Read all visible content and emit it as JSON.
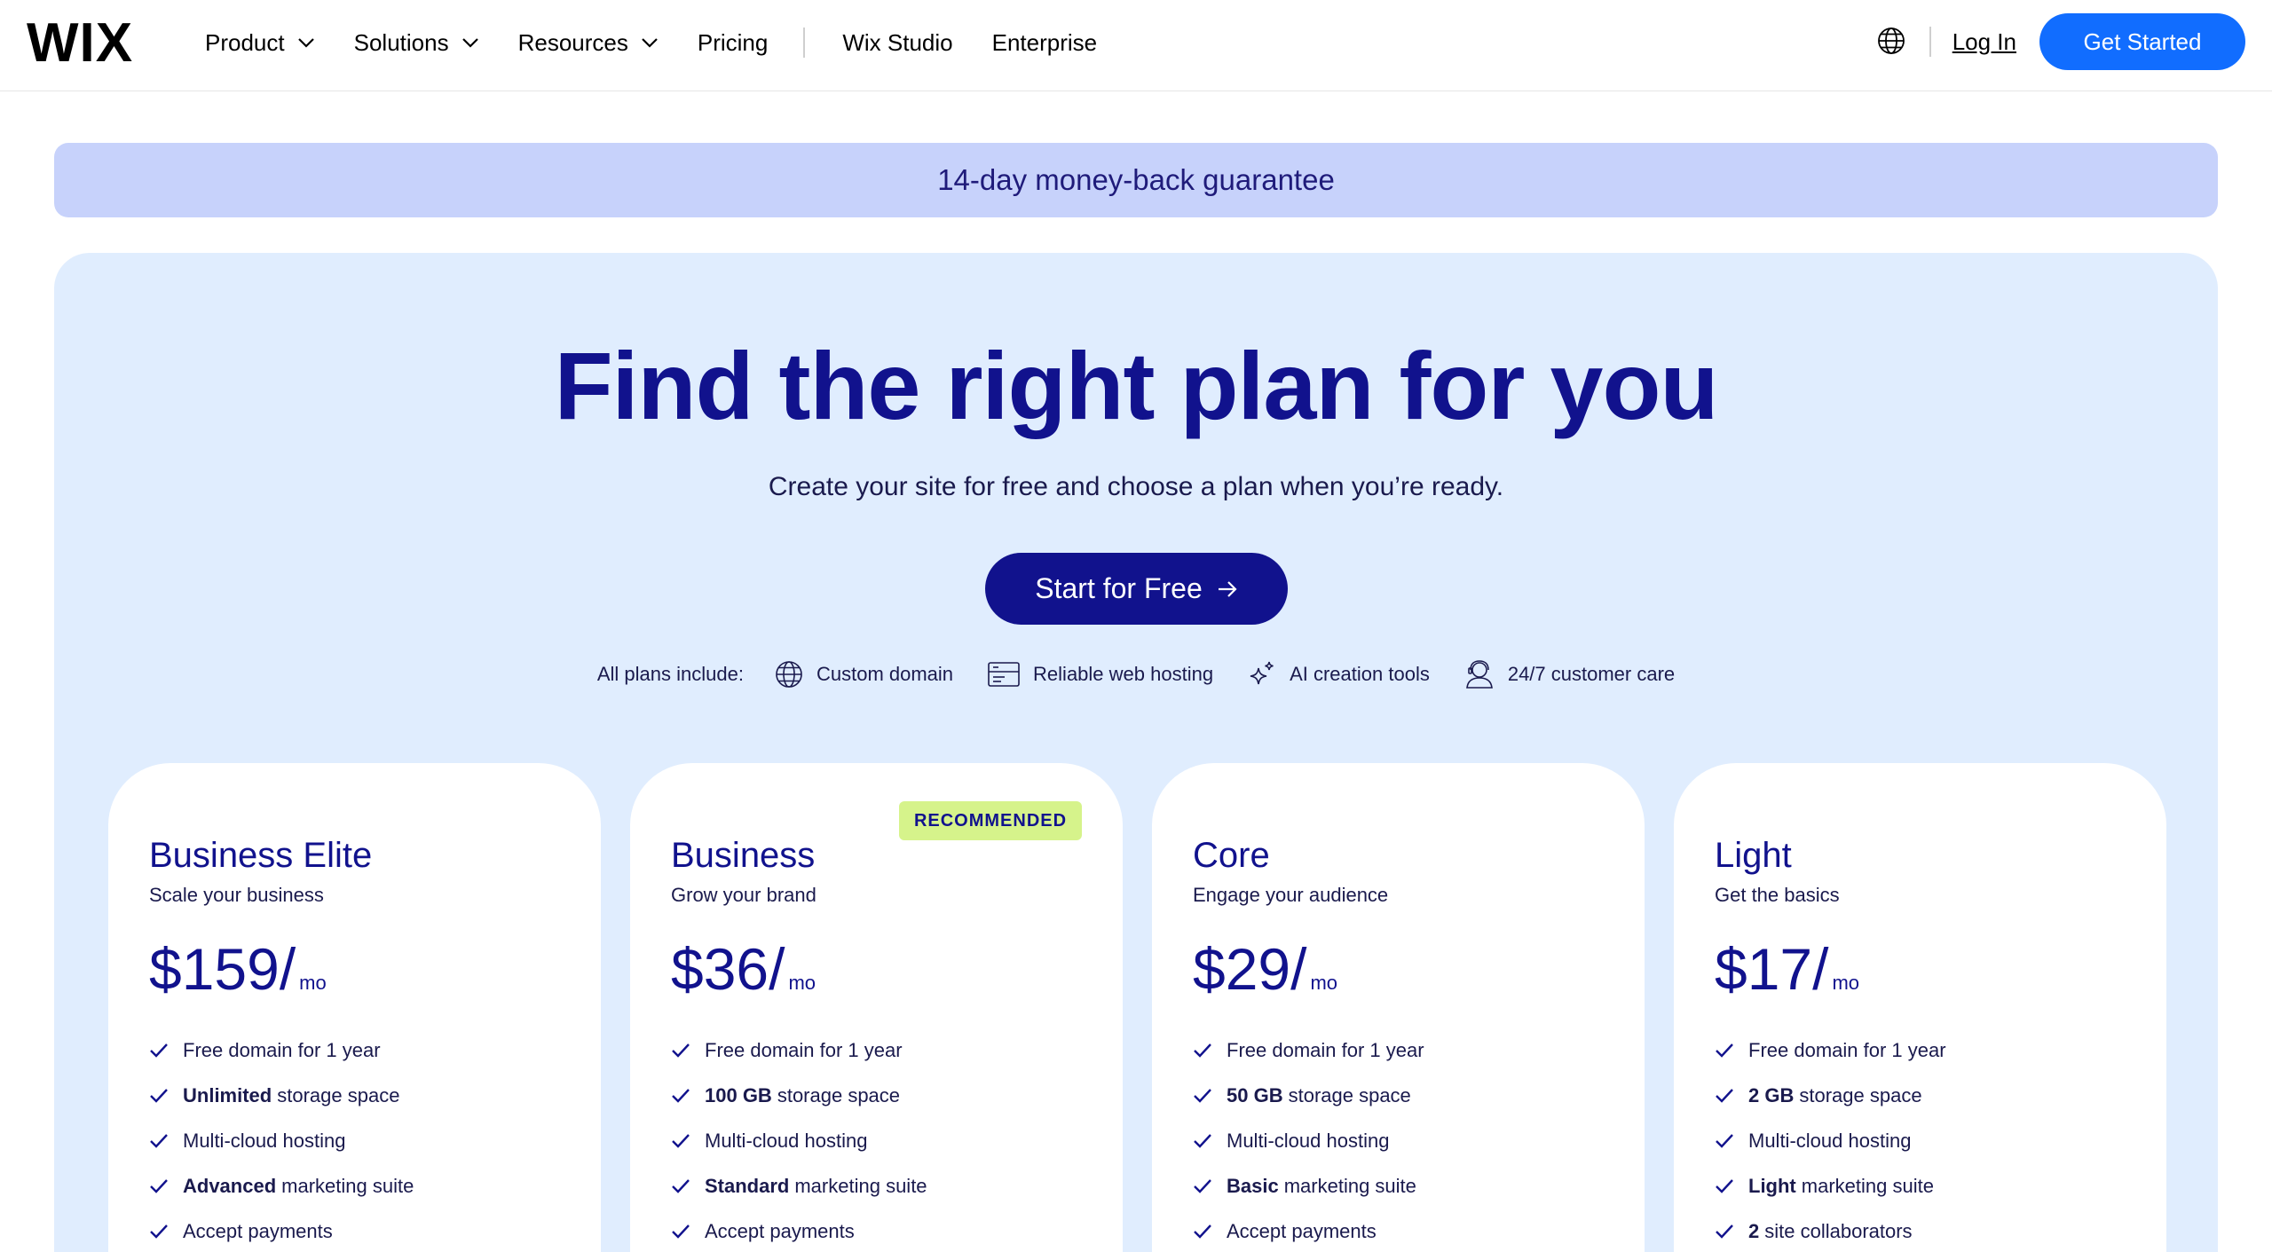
{
  "header": {
    "logo": "WIX",
    "nav": [
      {
        "label": "Product",
        "dropdown": true
      },
      {
        "label": "Solutions",
        "dropdown": true
      },
      {
        "label": "Resources",
        "dropdown": true
      },
      {
        "label": "Pricing",
        "dropdown": false
      }
    ],
    "nav_secondary": [
      {
        "label": "Wix Studio"
      },
      {
        "label": "Enterprise"
      }
    ],
    "login_label": "Log In",
    "cta_label": "Get Started"
  },
  "banner": {
    "text": "14-day money-back guarantee"
  },
  "hero": {
    "title": "Find the right plan for you",
    "subtitle": "Create your site for free and choose a plan when you’re ready.",
    "cta_label": "Start for Free"
  },
  "includes": {
    "label": "All plans include:",
    "items": [
      {
        "icon": "globe-icon",
        "label": "Custom domain"
      },
      {
        "icon": "hosting-icon",
        "label": "Reliable web hosting"
      },
      {
        "icon": "sparkle-icon",
        "label": "AI creation tools"
      },
      {
        "icon": "support-icon",
        "label": "24/7 customer care"
      }
    ]
  },
  "plans": [
    {
      "name": "Business Elite",
      "tagline": "Scale your business",
      "price": "$159/",
      "period": "mo",
      "badge": "",
      "features": [
        {
          "bold": "",
          "text": "Free domain for 1 year"
        },
        {
          "bold": "Unlimited",
          "text": "storage space"
        },
        {
          "bold": "",
          "text": "Multi-cloud hosting"
        },
        {
          "bold": "Advanced",
          "text": "marketing suite"
        },
        {
          "bold": "",
          "text": "Accept payments"
        }
      ]
    },
    {
      "name": "Business",
      "tagline": "Grow your brand",
      "price": "$36/",
      "period": "mo",
      "badge": "RECOMMENDED",
      "features": [
        {
          "bold": "",
          "text": "Free domain for 1 year"
        },
        {
          "bold": "100 GB",
          "text": "storage space"
        },
        {
          "bold": "",
          "text": "Multi-cloud hosting"
        },
        {
          "bold": "Standard",
          "text": "marketing suite"
        },
        {
          "bold": "",
          "text": "Accept payments"
        }
      ]
    },
    {
      "name": "Core",
      "tagline": "Engage your audience",
      "price": "$29/",
      "period": "mo",
      "badge": "",
      "features": [
        {
          "bold": "",
          "text": "Free domain for 1 year"
        },
        {
          "bold": "50 GB",
          "text": "storage space"
        },
        {
          "bold": "",
          "text": "Multi-cloud hosting"
        },
        {
          "bold": "Basic",
          "text": "marketing suite"
        },
        {
          "bold": "",
          "text": "Accept payments"
        }
      ]
    },
    {
      "name": "Light",
      "tagline": "Get the basics",
      "price": "$17/",
      "period": "mo",
      "badge": "",
      "features": [
        {
          "bold": "",
          "text": "Free domain for 1 year"
        },
        {
          "bold": "2 GB",
          "text": "storage space"
        },
        {
          "bold": "",
          "text": "Multi-cloud hosting"
        },
        {
          "bold": "Light",
          "text": "marketing suite"
        },
        {
          "bold": "2",
          "text": "site collaborators"
        }
      ]
    }
  ],
  "colors": {
    "brand_blue": "#116dff",
    "navy": "#11128d",
    "banner_bg": "#c7d2fb",
    "panel_bg": "#e0edfe",
    "badge_bg": "#d6f38b"
  }
}
